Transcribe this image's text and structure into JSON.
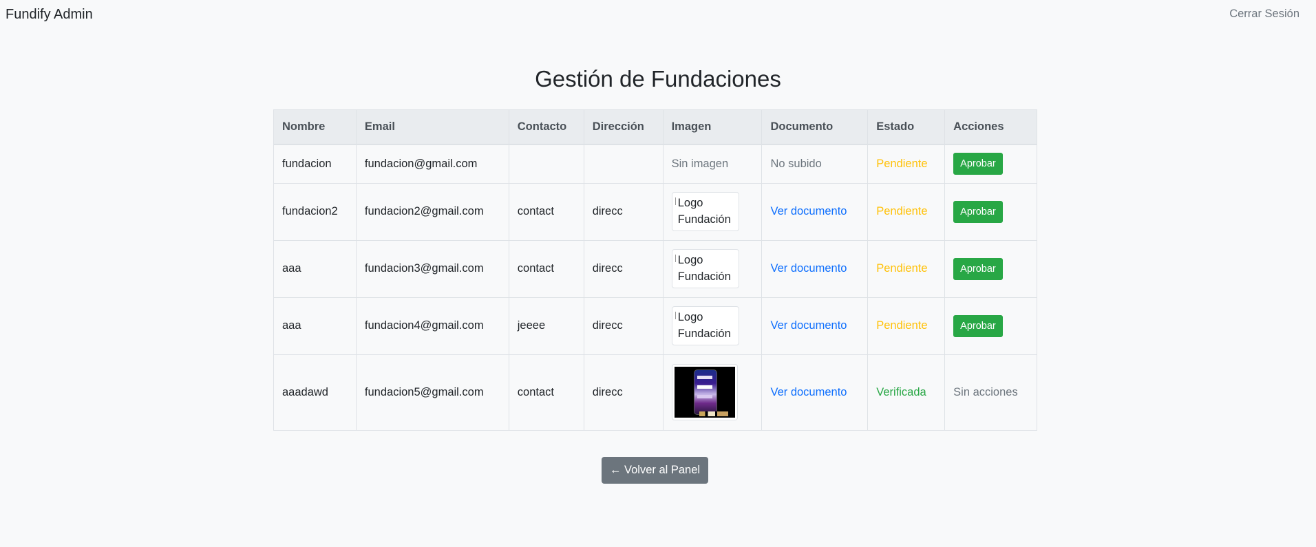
{
  "nav": {
    "brand": "Fundify Admin",
    "logout": "Cerrar Sesión"
  },
  "page": {
    "title": "Gestión de Fundaciones"
  },
  "table": {
    "headers": [
      "Nombre",
      "Email",
      "Contacto",
      "Dirección",
      "Imagen",
      "Documento",
      "Estado",
      "Acciones"
    ],
    "rows": [
      {
        "nombre": "fundacion",
        "email": "fundacion@gmail.com",
        "contacto": "",
        "direccion": "",
        "imagen_text": "Sin imagen",
        "documento": "No subido",
        "estado": "Pendiente",
        "accion": "Aprobar"
      },
      {
        "nombre": "fundacion2",
        "email": "fundacion2@gmail.com",
        "contacto": "contact",
        "direccion": "direcc",
        "imagen_alt": "Logo Fundación",
        "documento": "Ver documento",
        "estado": "Pendiente",
        "accion": "Aprobar"
      },
      {
        "nombre": "aaa",
        "email": "fundacion3@gmail.com",
        "contacto": "contact",
        "direccion": "direcc",
        "imagen_alt": "Logo Fundación",
        "documento": "Ver documento",
        "estado": "Pendiente",
        "accion": "Aprobar"
      },
      {
        "nombre": "aaa",
        "email": "fundacion4@gmail.com",
        "contacto": "jeeee",
        "direccion": "direcc",
        "imagen_alt": "Logo Fundación",
        "documento": "Ver documento",
        "estado": "Pendiente",
        "accion": "Aprobar"
      },
      {
        "nombre": "aaadawd",
        "email": "fundacion5@gmail.com",
        "contacto": "contact",
        "direccion": "direcc",
        "documento": "Ver documento",
        "estado": "Verificada",
        "accion_text": "Sin acciones"
      }
    ]
  },
  "footer": {
    "back_button": "← Volver al Panel"
  },
  "colors": {
    "pending": "#ffc107",
    "verified": "#28a745",
    "link": "#0d6efd",
    "approve_button": "#28a745",
    "back_button": "#6c757d",
    "header_bg": "#e9ecef"
  }
}
